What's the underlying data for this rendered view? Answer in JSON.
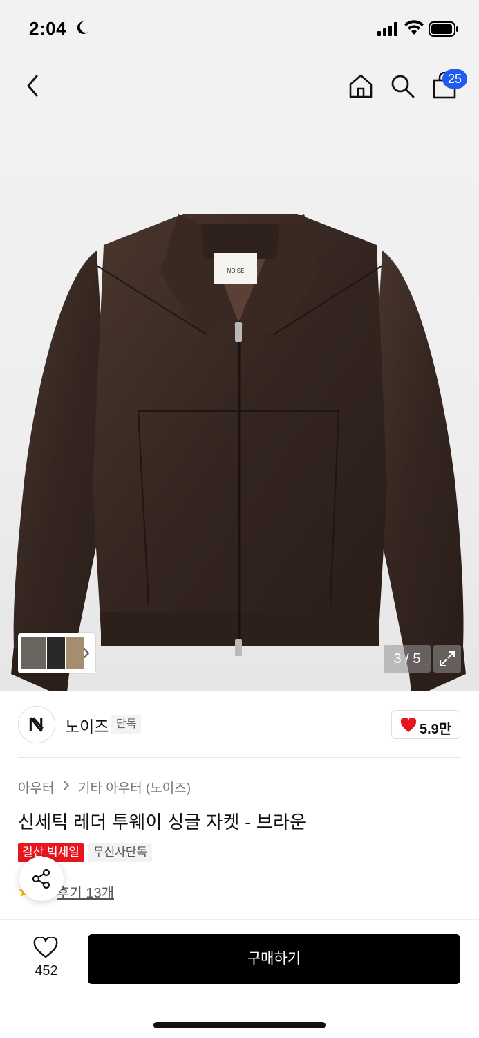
{
  "status_bar": {
    "time": "2:04"
  },
  "nav": {
    "cart_count": "25"
  },
  "gallery": {
    "pager_text": "3 / 5",
    "jacket_label": "NOISE"
  },
  "brand": {
    "name": "노이즈",
    "badge": "단독",
    "like_count": "5.9만"
  },
  "breadcrumb": {
    "category": "아우터",
    "subcategory": "기타 아우터 (노이즈)"
  },
  "product": {
    "title": "신세틱 레더 투웨이 싱글 자켓 - 브라운",
    "tags": [
      "결산 빅세일",
      "무신사단독"
    ],
    "review_text": "후기 13개"
  },
  "bottom_bar": {
    "wish_count": "452",
    "buy_label": "구매하기"
  },
  "colors": {
    "badge_blue": "#1e5cf0",
    "sale_red": "#e8141e",
    "heart_red": "#e8141e",
    "buy_black": "#000000",
    "jacket_brown": "#3a2a22"
  }
}
